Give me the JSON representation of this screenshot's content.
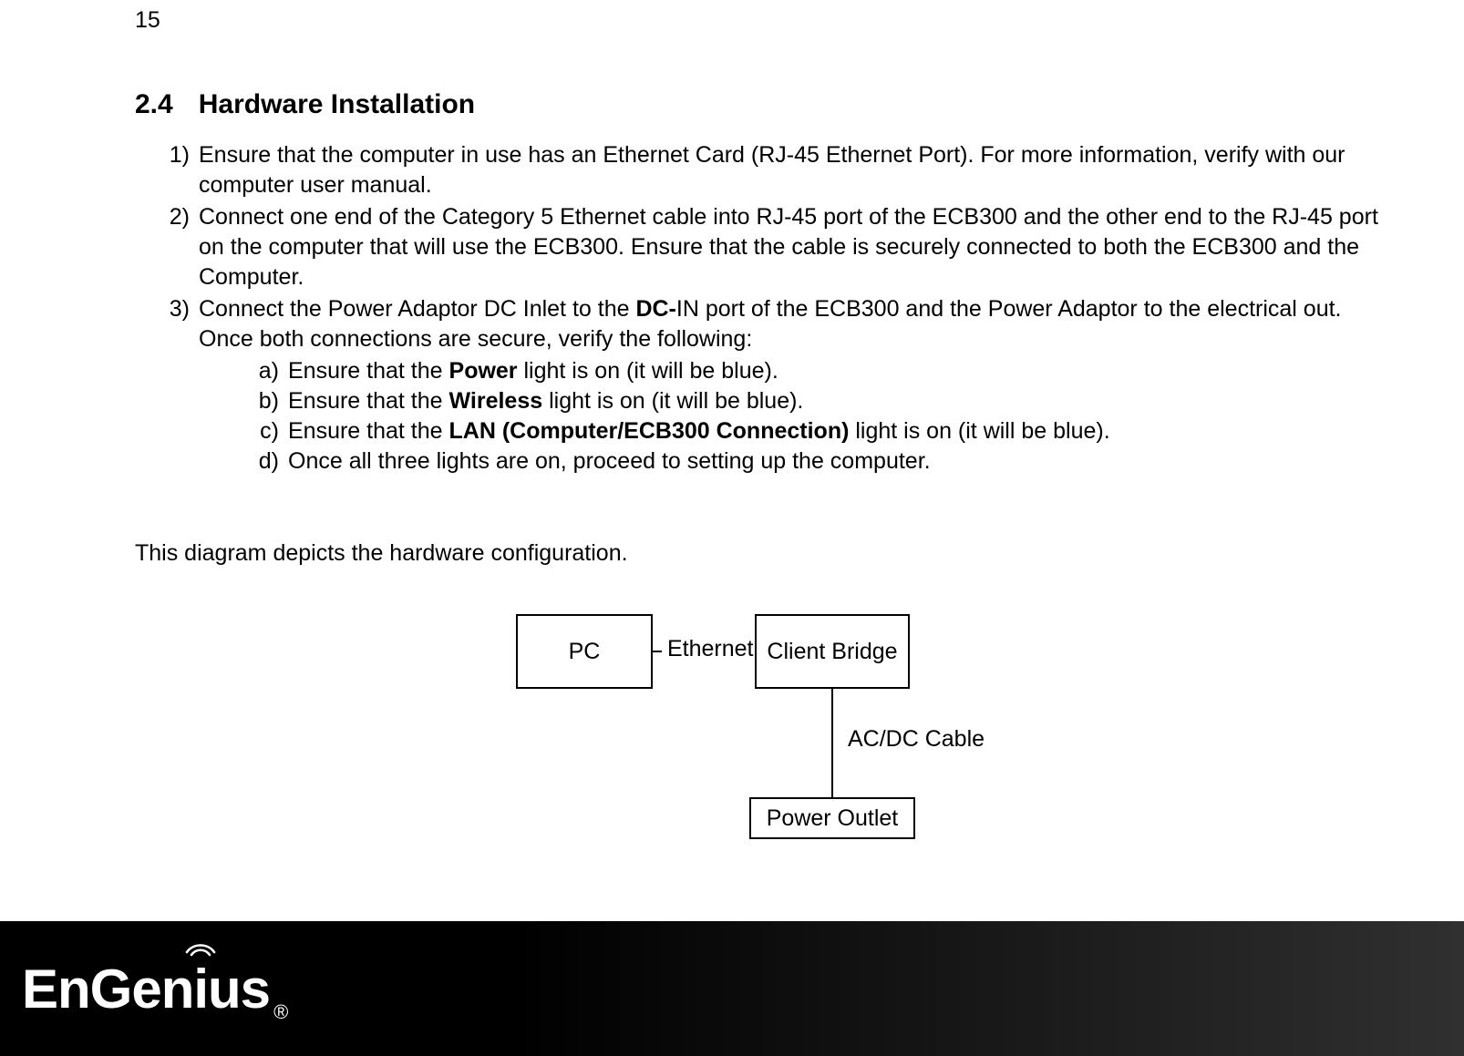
{
  "page_number": "15",
  "section": {
    "number": "2.4",
    "title": "Hardware Installation"
  },
  "steps": [
    {
      "marker": "1)",
      "text_a": "Ensure that the computer in use has an Ethernet Card (RJ-45 Ethernet Port). For more information, verify with our computer user manual."
    },
    {
      "marker": "2)",
      "text_a": "Connect one end of the Category 5 Ethernet cable into RJ-45 port of the ECB300 and the other end to the RJ-45 port on the computer that will use the ECB300. Ensure that the cable is securely connected to both the ECB300 and the Computer."
    },
    {
      "marker": "3)",
      "text_a": "Connect the Power Adaptor DC Inlet to the ",
      "bold_a": "DC-",
      "text_b": "IN port of the ECB300 and the Power Adaptor to the electrical out. Once both connections are secure, verify the following:"
    }
  ],
  "substeps": [
    {
      "marker": "a)",
      "pre": "Ensure that the ",
      "bold": "Power",
      "post": " light is on (it will be blue)."
    },
    {
      "marker": "b)",
      "pre": "Ensure that the ",
      "bold": "Wireless",
      "post": " light is on (it will be blue)."
    },
    {
      "marker": "c)",
      "pre": "Ensure that the ",
      "bold": "LAN (Computer/ECB300 Connection)",
      "post": " light is on (it will be blue)."
    },
    {
      "marker": "d)",
      "pre": "Once all three lights are on, proceed to setting up the computer.",
      "bold": "",
      "post": ""
    }
  ],
  "diagram_caption": "This diagram depicts the hardware configuration.",
  "diagram": {
    "pc": "PC",
    "ethernet": "Ethernet",
    "client_bridge": "Client Bridge",
    "acdc": "AC/DC Cable",
    "power_outlet": "Power Outlet"
  },
  "logo": {
    "name": "EnGenius",
    "registered": "®"
  }
}
